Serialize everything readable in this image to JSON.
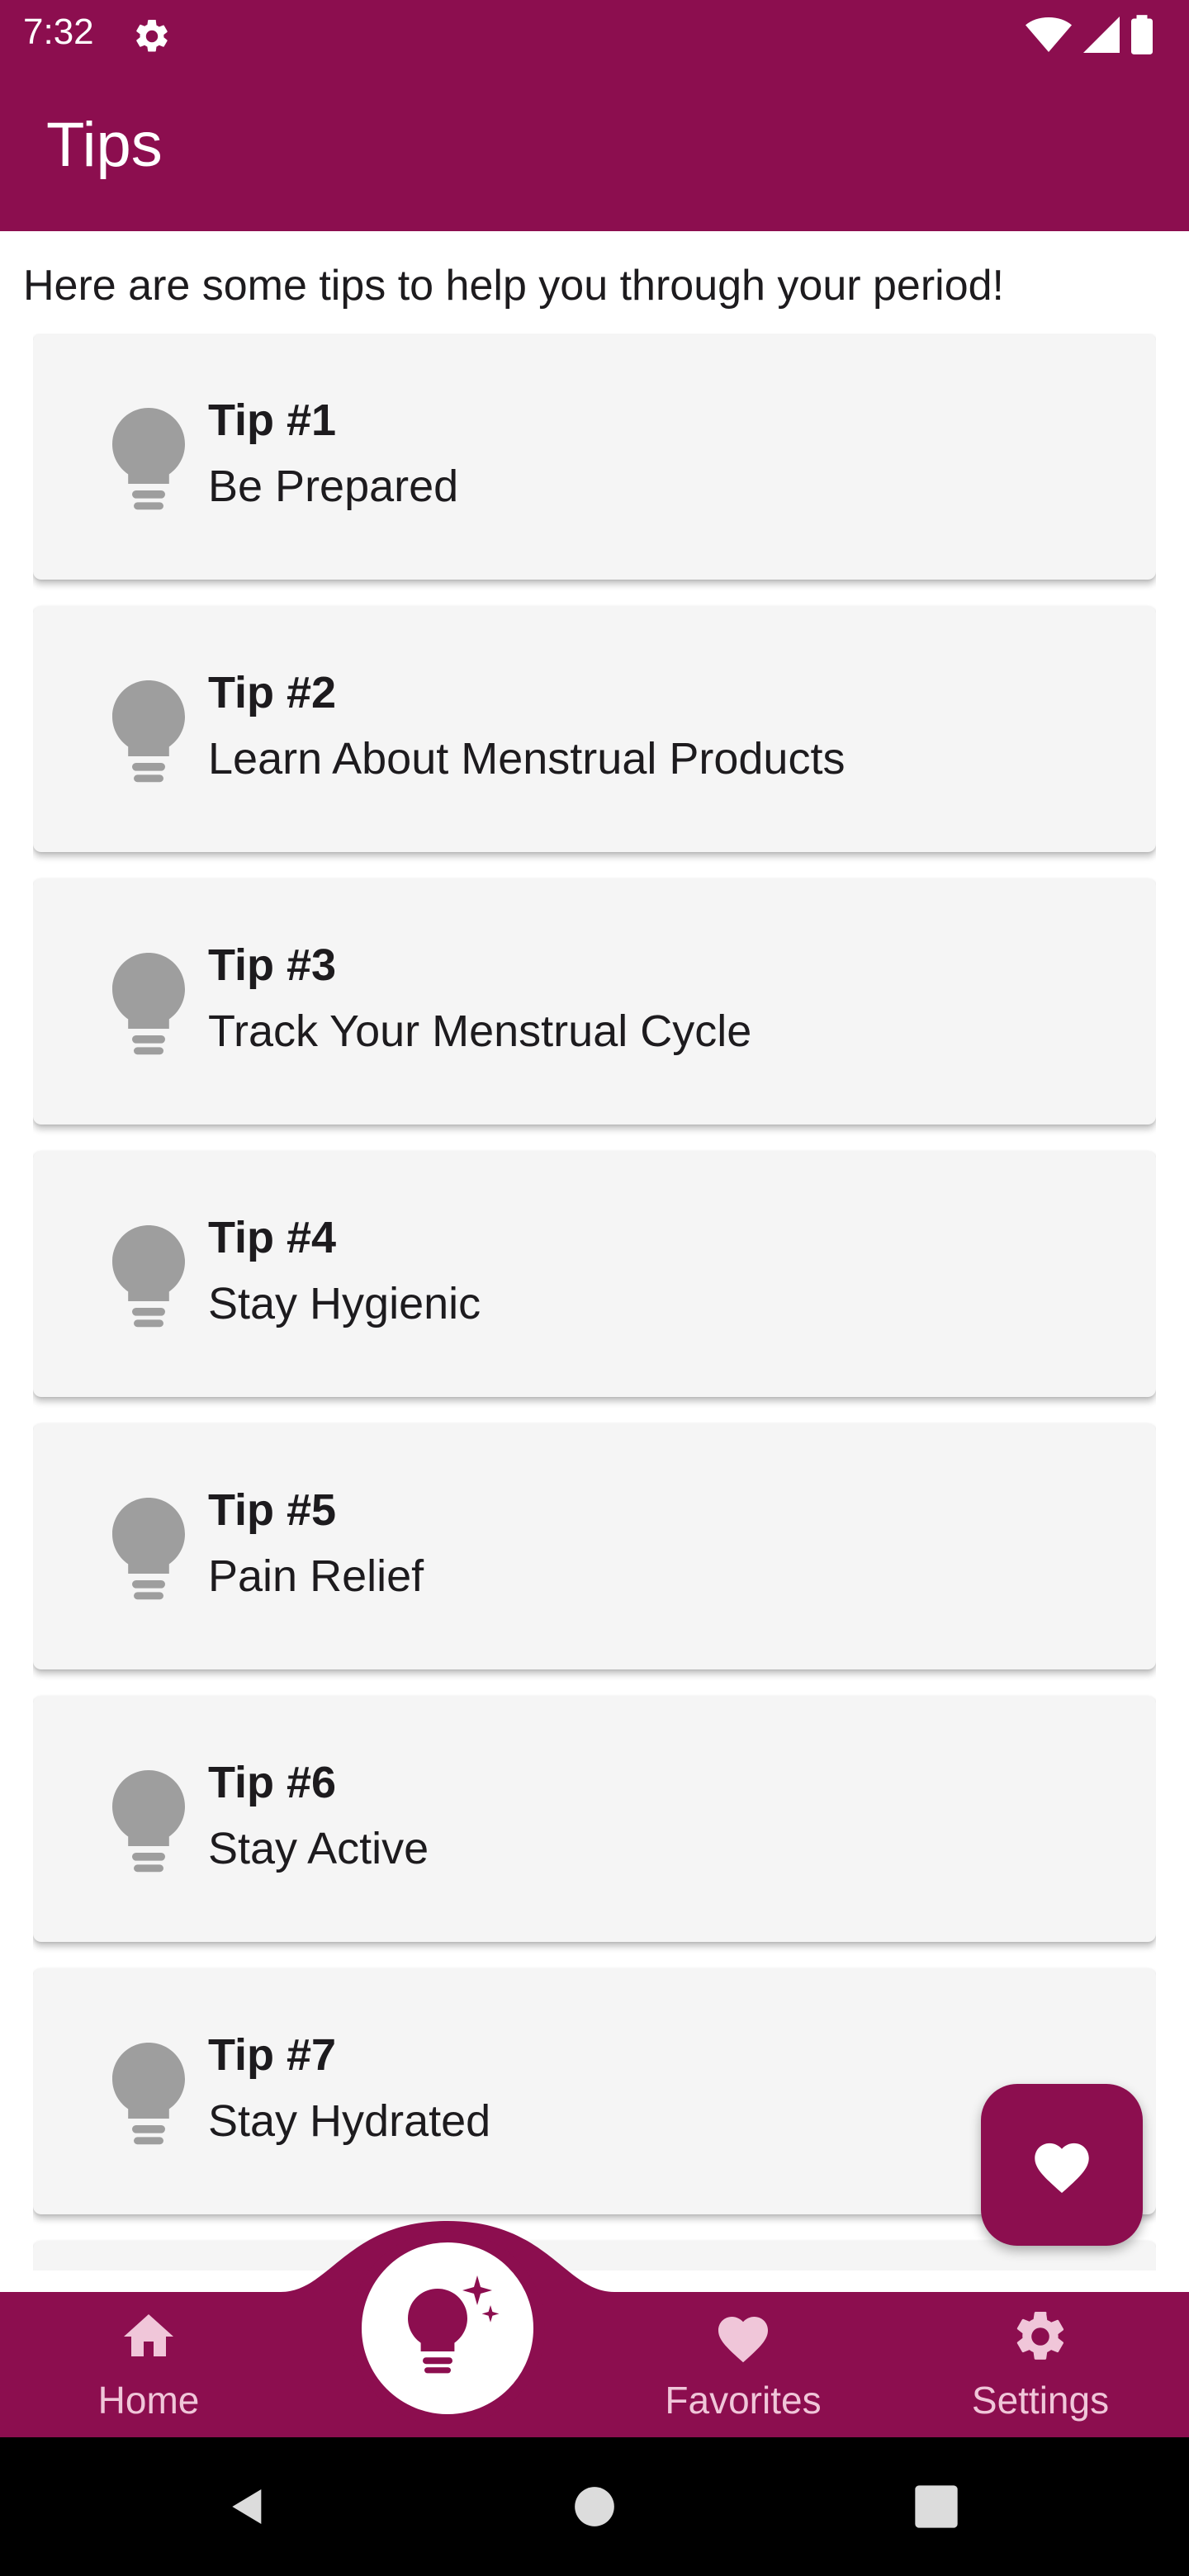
{
  "status_bar": {
    "time": "7:32"
  },
  "app_bar": {
    "title": "Tips"
  },
  "intro_text": "Here are some tips to help you through your period!",
  "tips": [
    {
      "number": "Tip #1",
      "title": "Be Prepared"
    },
    {
      "number": "Tip #2",
      "title": "Learn About Menstrual Products"
    },
    {
      "number": "Tip #3",
      "title": "Track Your Menstrual Cycle"
    },
    {
      "number": "Tip #4",
      "title": "Stay Hygienic"
    },
    {
      "number": "Tip #5",
      "title": "Pain Relief"
    },
    {
      "number": "Tip #6",
      "title": "Stay Active"
    },
    {
      "number": "Tip #7",
      "title": "Stay Hydrated"
    },
    {
      "number": "",
      "title": ""
    }
  ],
  "fab": {
    "icon": "heart-icon"
  },
  "bottom_nav": {
    "items": [
      {
        "label": "Home",
        "icon": "home-icon"
      },
      {
        "label": "",
        "icon": "lightbulb-sparkle-icon",
        "selected": true
      },
      {
        "label": "Favorites",
        "icon": "heart-icon"
      },
      {
        "label": "Settings",
        "icon": "gear-icon"
      }
    ]
  },
  "colors": {
    "brand": "#8c0e4f",
    "card_bg": "#f5f5f5",
    "bulb_gray": "#9e9e9e",
    "nav_inactive": "#f0c6d9"
  }
}
